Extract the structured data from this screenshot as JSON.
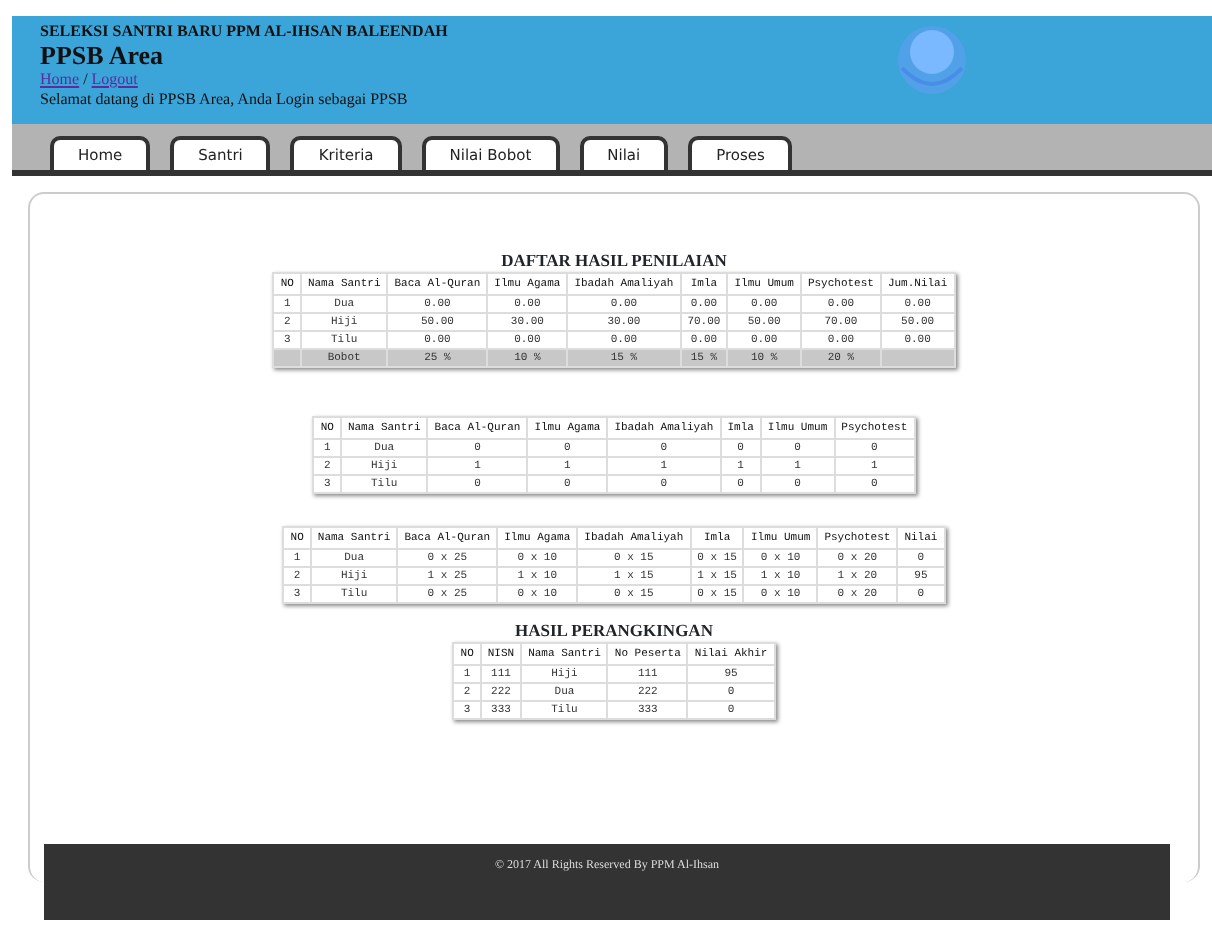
{
  "header": {
    "subtitle": "SELEKSI SANTRI BARU PPM AL-IHSAN BALEENDAH",
    "title": "PPSB Area",
    "links": [
      "Home",
      "Logout"
    ],
    "separator": "/",
    "welcome": "Selamat datang di PPSB Area, Anda Login sebagai PPSB"
  },
  "tabs": [
    {
      "label": "Home",
      "selected": false
    },
    {
      "label": "Santri",
      "selected": false
    },
    {
      "label": "Kriteria",
      "selected": false
    },
    {
      "label": "Nilai Bobot",
      "selected": false
    },
    {
      "label": "Nilai",
      "selected": false
    },
    {
      "label": "Proses",
      "selected": false
    }
  ],
  "tables": [
    {
      "title": "DAFTAR HASIL PENILAIAN",
      "columns": [
        "NO",
        "Nama Santri",
        "Baca Al-Quran",
        "Ilmu Agama",
        "Ibadah Amaliyah",
        "Imla",
        "Ilmu Umum",
        "Psychotest",
        "Jum.Nilai"
      ],
      "rows": [
        [
          "1",
          "Dua",
          "0.00",
          "0.00",
          "0.00",
          "0.00",
          "0.00",
          "0.00",
          "0.00"
        ],
        [
          "2",
          "Hiji",
          "50.00",
          "30.00",
          "30.00",
          "70.00",
          "50.00",
          "70.00",
          "50.00"
        ],
        [
          "3",
          "Tilu",
          "0.00",
          "0.00",
          "0.00",
          "0.00",
          "0.00",
          "0.00",
          "0.00"
        ]
      ],
      "footer_row": {
        "label": "Bobot",
        "cells": [
          "25 %",
          "10 %",
          "15 %",
          "15 %",
          "10 %",
          "20 %"
        ]
      }
    },
    {
      "columns": [
        "NO",
        "Nama Santri",
        "Baca Al-Quran",
        "Ilmu Agama",
        "Ibadah Amaliyah",
        "Imla",
        "Ilmu Umum",
        "Psychotest"
      ],
      "rows": [
        [
          "1",
          "Dua",
          "0",
          "0",
          "0",
          "0",
          "0",
          "0"
        ],
        [
          "2",
          "Hiji",
          "1",
          "1",
          "1",
          "1",
          "1",
          "1"
        ],
        [
          "3",
          "Tilu",
          "0",
          "0",
          "0",
          "0",
          "0",
          "0"
        ]
      ]
    },
    {
      "columns": [
        "NO",
        "Nama Santri",
        "Baca Al-Quran",
        "Ilmu Agama",
        "Ibadah Amaliyah",
        "Imla",
        "Ilmu Umum",
        "Psychotest",
        "Nilai"
      ],
      "rows": [
        [
          "1",
          "Dua",
          "0 x 25",
          "0 x 10",
          "0 x 15",
          "0 x 15",
          "0 x 10",
          "0 x 20",
          "0"
        ],
        [
          "2",
          "Hiji",
          "1 x 25",
          "1 x 10",
          "1 x 15",
          "1 x 15",
          "1 x 10",
          "1 x 20",
          "95"
        ],
        [
          "3",
          "Tilu",
          "0 x 25",
          "0 x 10",
          "0 x 15",
          "0 x 15",
          "0 x 10",
          "0 x 20",
          "0"
        ]
      ]
    },
    {
      "title": "HASIL PERANGKINGAN",
      "columns": [
        "NO",
        "NISN",
        "Nama Santri",
        "No Peserta",
        "Nilai Akhir"
      ],
      "rows": [
        [
          "1",
          "111",
          "Hiji",
          "111",
          "95"
        ],
        [
          "2",
          "222",
          "Dua",
          "222",
          "0"
        ],
        [
          "3",
          "333",
          "Tilu",
          "333",
          "0"
        ]
      ]
    }
  ],
  "footer": "© 2017 All Rights Reserved By PPM Al-Ihsan"
}
